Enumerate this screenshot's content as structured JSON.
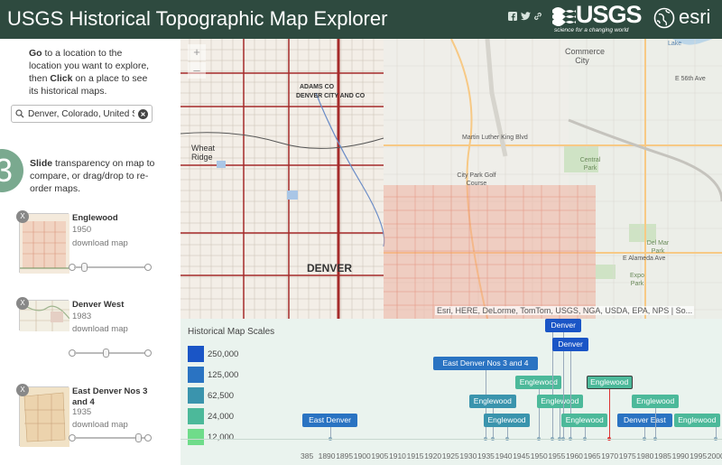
{
  "header": {
    "title": "USGS Historical Topographic Map Explorer",
    "social": [
      "facebook-icon",
      "twitter-icon",
      "link-icon"
    ],
    "usgs_word": "USGS",
    "usgs_tagline": "science for a changing world",
    "esri_word": "esri",
    "colors": {
      "bar": "#2e4a3f"
    }
  },
  "sidebar": {
    "step_go": {
      "keyword": "Go",
      "text": " to a location to the location you want to explore, then ",
      "keyword2": "Click",
      "text2": " on a place to see its historical maps."
    },
    "search": {
      "value": "Denver, Colorado, United S",
      "icon": "search-icon",
      "clear_icon": "clear-icon"
    },
    "step_number": "3",
    "step_slide": {
      "keyword": "Slide",
      "text": " transparency on map to compare, or drag/drop to re-order maps."
    },
    "maps": [
      {
        "title": "Englewood",
        "year": "1950",
        "download": "download map",
        "opacity": 0.07
      },
      {
        "title": "Denver West",
        "year": "1983",
        "download": "download map",
        "opacity": 0.41
      },
      {
        "title": "East Denver Nos 3 and 4",
        "year": "1935",
        "download": "download map",
        "opacity": 0.9
      }
    ]
  },
  "map": {
    "zoom_in": "+",
    "zoom_out": "–",
    "labels": [
      {
        "text": "Commerce City"
      },
      {
        "text": "DENVER"
      },
      {
        "text": "DENVER CITY AND CO"
      },
      {
        "text": "ADAMS CO"
      },
      {
        "text": "Wheat Ridge"
      },
      {
        "text": "City Park Golf Course"
      },
      {
        "text": "Central Park"
      },
      {
        "text": "Del Mar Park"
      },
      {
        "text": "Martin Luther King Blvd"
      },
      {
        "text": "E Alameda Ave"
      },
      {
        "text": "E 56th Ave"
      },
      {
        "text": "Lake"
      },
      {
        "text": "Expo Park"
      }
    ],
    "attribution": "Esri, HERE, DeLorme, TomTom, USGS, NGA, USDA, EPA, NPS | So..."
  },
  "timeline": {
    "legend_title": "Historical Map Scales",
    "legend": [
      {
        "label": "250,000",
        "color": "#1a55c6"
      },
      {
        "label": "125,000",
        "color": "#2a73c2"
      },
      {
        "label": "62,500",
        "color": "#3a94ad"
      },
      {
        "label": "24,000",
        "color": "#4cb99a"
      },
      {
        "label": "12,000",
        "color": "#6fdc8a"
      }
    ],
    "maps": [
      {
        "label": "East Denver",
        "year": 1891,
        "row": 0,
        "color": "#2a73c2"
      },
      {
        "label": "East Denver Nos 3 and 4",
        "year": 1935,
        "row": 3,
        "color": "#2a73c2"
      },
      {
        "label": "Englewood",
        "year": 1937,
        "row": 1,
        "color": "#3a94ad"
      },
      {
        "label": "Englewood",
        "year": 1941,
        "row": 0,
        "color": "#3a94ad"
      },
      {
        "label": "Englewood",
        "year": 1950,
        "row": 2,
        "color": "#4cb99a"
      },
      {
        "label": "Denver",
        "year": 1954,
        "row": 6,
        "color": "#1a55c6"
      },
      {
        "label": "Englewood",
        "year": 1956,
        "row": 1,
        "color": "#4cb99a"
      },
      {
        "label": "Denver",
        "year": 1957,
        "row": 5,
        "color": "#1a55c6"
      },
      {
        "label": "Denver",
        "year": 1959,
        "row": 4,
        "color": "#1a55c6"
      },
      {
        "label": "Englewood",
        "year": 1963,
        "row": 0,
        "color": "#4cb99a"
      },
      {
        "label": "Englewood",
        "year": 1970,
        "row": 2,
        "color": "#4cb99a",
        "selected": true
      },
      {
        "label": "Denver East",
        "year": 1980,
        "row": 0,
        "color": "#2a73c2"
      },
      {
        "label": "Englewood",
        "year": 1983,
        "row": 1,
        "color": "#4cb99a"
      },
      {
        "label": "Englewood",
        "year": 2000,
        "row": 0,
        "color": "#4cb99a"
      }
    ],
    "axis": {
      "start": 1885,
      "end": 2000,
      "step": 5
    },
    "tick_labels": [
      "385",
      "1890",
      "1895",
      "1900",
      "1905",
      "1910",
      "1915",
      "1920",
      "1925",
      "1930",
      "1935",
      "1940",
      "1945",
      "1950",
      "1955",
      "1960",
      "1965",
      "1970",
      "1975",
      "1980",
      "1985",
      "1990",
      "1995",
      "2000"
    ]
  }
}
